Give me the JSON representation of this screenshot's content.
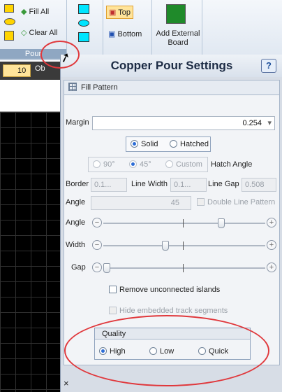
{
  "ribbon": {
    "fill_all": "Fill All",
    "clear_all": "Clear All",
    "pour_group": "Pour",
    "top": "Top",
    "bottom": "Bottom",
    "add_external": "Add External Board"
  },
  "toolbar": {
    "count": "10",
    "ob": "Ob"
  },
  "panel": {
    "title": "Copper Pour Settings",
    "help": "?",
    "tab": "Fill Pattern",
    "margin_label": "Margin",
    "margin_value": "0.254",
    "solid": "Solid",
    "hatched": "Hatched",
    "a90": "90°",
    "a45": "45°",
    "custom": "Custom",
    "hatch_angle": "Hatch Angle",
    "border_label": "Border",
    "border_value": "0.1...",
    "line_width_label": "Line Width",
    "line_width_value": "0.1...",
    "line_gap_label": "Line Gap",
    "line_gap_value": "0.508",
    "angle_label": "Angle",
    "angle_value": "45",
    "double_line": "Double Line Pattern",
    "slider_angle": "Angle",
    "slider_width": "Width",
    "slider_gap": "Gap",
    "remove_islands": "Remove unconnected islands",
    "hide_embedded": "Hide embedded track segments",
    "quality_title": "Quality",
    "high": "High",
    "low": "Low",
    "quick": "Quick",
    "close": "×"
  },
  "colors": {
    "accent": "#2b6cd6",
    "highlight_ring": "#e0383c"
  }
}
